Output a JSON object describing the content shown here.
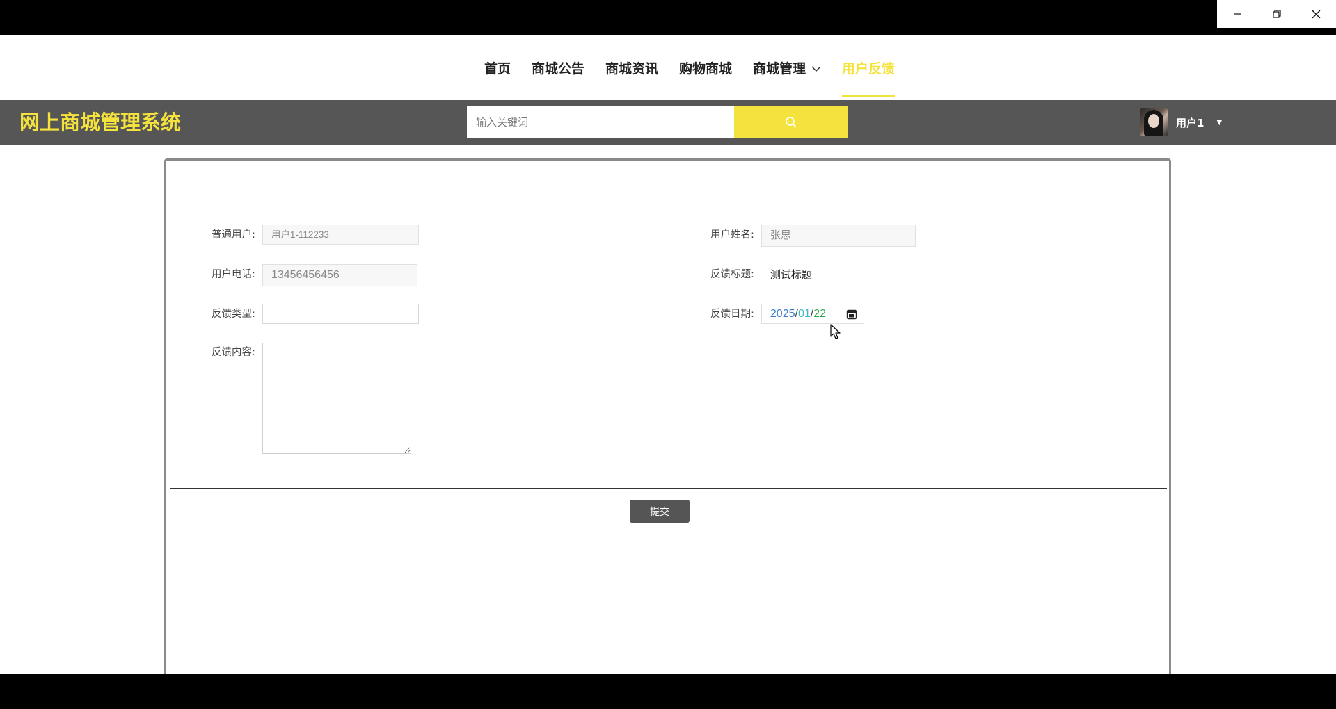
{
  "nav": {
    "items": [
      {
        "label": "首页"
      },
      {
        "label": "商城公告"
      },
      {
        "label": "商城资讯"
      },
      {
        "label": "购物商城"
      },
      {
        "label": "商城管理"
      },
      {
        "label": "用户反馈"
      }
    ],
    "active": "用户反馈"
  },
  "header": {
    "brand": "网上商城管理系统",
    "search_placeholder": "输入关键词",
    "user_name": "用户1"
  },
  "form": {
    "user_account_label": "普通用户:",
    "user_account_value": "用户1-112233",
    "user_real_name_label": "用户姓名:",
    "user_real_name_value": "张思",
    "phone_label": "用户电话:",
    "phone_value": "13456456456",
    "feedback_title_label": "反馈标题:",
    "feedback_title_value": "测试标题",
    "feedback_type_label": "反馈类型:",
    "feedback_type_value": "",
    "feedback_date_label": "反馈日期:",
    "feedback_date_year": "2025",
    "feedback_date_month": "01",
    "feedback_date_day": "22",
    "feedback_date_sep": "/",
    "feedback_content_label": "反馈内容:",
    "feedback_content_value": "",
    "submit_label": "提交"
  },
  "colors": {
    "accent": "#f5e33d",
    "header_bg": "#565656",
    "button_bg": "#555555"
  },
  "icons": {
    "search": "search-icon",
    "calendar": "calendar-icon",
    "dropdown": "chevron-down-icon"
  }
}
